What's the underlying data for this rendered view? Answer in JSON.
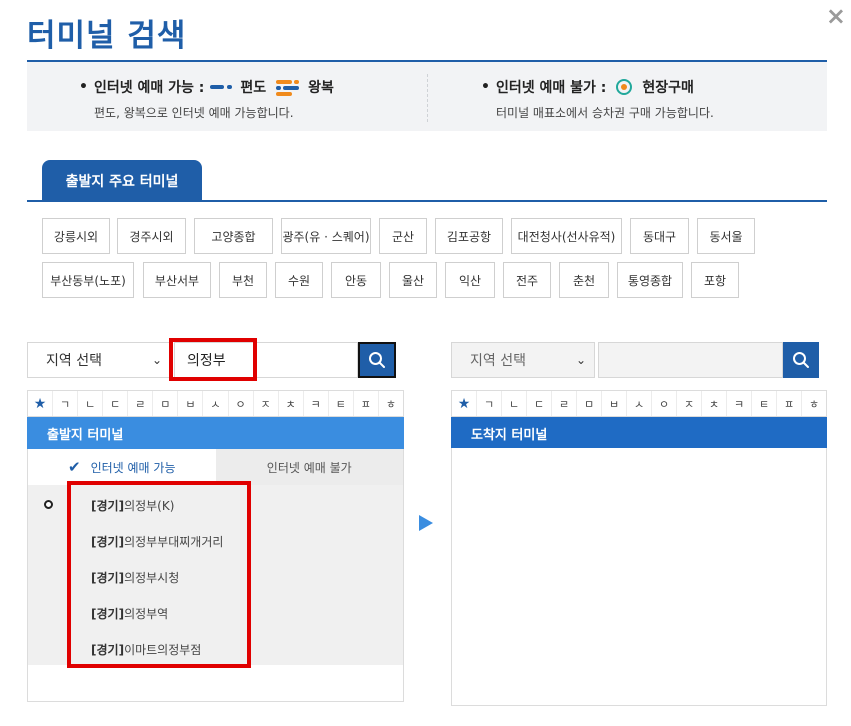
{
  "header": {
    "title": "터미널 검색",
    "close": "×"
  },
  "legend": {
    "online_available": {
      "label": "인터넷 예매 가능 :",
      "oneway": "편도",
      "roundtrip": "왕복",
      "desc": "편도, 왕복으로 인터넷 예매 가능합니다."
    },
    "online_unavailable": {
      "label": "인터넷 예매 불가 :",
      "onsite": "현장구매",
      "desc": "터미널 매표소에서 승차권 구매 가능합니다."
    },
    "bullet": "•"
  },
  "major_tab": {
    "label": "출발지 주요 터미널"
  },
  "terminals_row1": [
    "강릉시외",
    "경주시외",
    "고양종합",
    "광주(유 · 스퀘어)",
    "군산",
    "김포공항",
    "대전청사(선사유적)",
    "동대구",
    "동서울"
  ],
  "terminals_row2": [
    "부산동부(노포)",
    "부산서부",
    "부천",
    "수원",
    "안동",
    "울산",
    "익산",
    "전주",
    "춘천",
    "통영종합",
    "포항"
  ],
  "departure": {
    "region_select": "지역 선택",
    "search_value": "의정부",
    "header": "출발지 터미널",
    "tab_available": "인터넷 예매 가능",
    "tab_unavailable": "인터넷 예매 불가",
    "results": [
      {
        "region": "[경기]",
        "name": "의정부(K)"
      },
      {
        "region": "[경기]",
        "name": "의정부부대찌개거리"
      },
      {
        "region": "[경기]",
        "name": "의정부시청"
      },
      {
        "region": "[경기]",
        "name": "의정부역"
      },
      {
        "region": "[경기]",
        "name": "이마트의정부점"
      }
    ]
  },
  "arrival": {
    "region_select": "지역 선택",
    "search_value": "",
    "header": "도착지 터미널"
  },
  "consonants": [
    "ㄱ",
    "ㄴ",
    "ㄷ",
    "ㄹ",
    "ㅁ",
    "ㅂ",
    "ㅅ",
    "ㅇ",
    "ㅈ",
    "ㅊ",
    "ㅋ",
    "ㅌ",
    "ㅍ",
    "ㅎ"
  ],
  "icons": {
    "star": "★",
    "check": "✔",
    "chevron": "⌄"
  },
  "colors": {
    "primary": "#1f5ea8",
    "header_light": "#3a8de0",
    "highlight": "#e00000",
    "orange": "#f08a1c",
    "teal": "#21a89b"
  }
}
